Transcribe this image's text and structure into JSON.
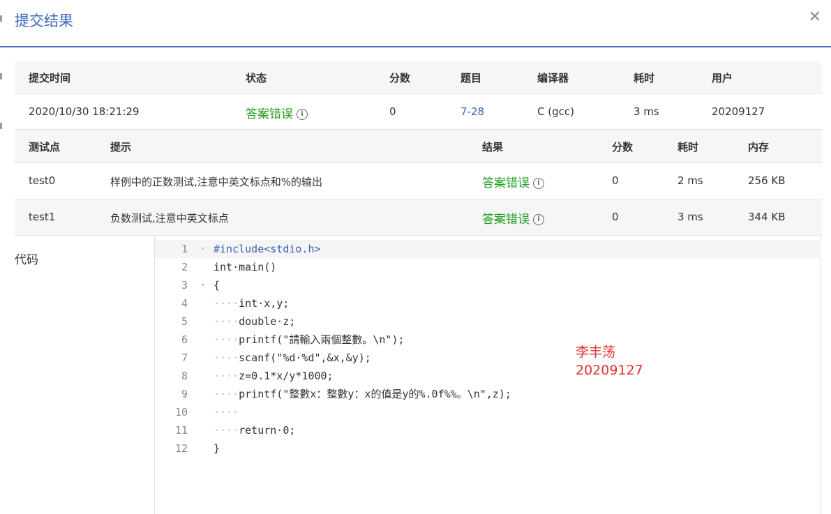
{
  "dialog": {
    "title": "提交结果",
    "close_icon": "close-icon"
  },
  "submission": {
    "headers": [
      "提交时间",
      "状态",
      "分数",
      "题目",
      "编译器",
      "耗时",
      "用户"
    ],
    "row": {
      "time": "2020/10/30 18:21:29",
      "status": "答案错误",
      "score": "0",
      "problem": "7-28",
      "compiler": "C (gcc)",
      "elapsed": "3 ms",
      "user": "20209127"
    }
  },
  "tests": {
    "headers": [
      "测试点",
      "提示",
      "结果",
      "分数",
      "耗时",
      "内存"
    ],
    "rows": [
      {
        "point": "test0",
        "hint": "样例中的正数测试,注意中英文标点和%的输出",
        "result": "答案错误",
        "score": "0",
        "elapsed": "2 ms",
        "memory": "256 KB"
      },
      {
        "point": "test1",
        "hint": "负数测试,注意中英文标点",
        "result": "答案错误",
        "score": "0",
        "elapsed": "3 ms",
        "memory": "344 KB"
      }
    ]
  },
  "code": {
    "label": "代码",
    "lines": [
      {
        "n": "1",
        "fold": "▾",
        "indent": "",
        "text": "#include<stdio.h>"
      },
      {
        "n": "2",
        "fold": "",
        "indent": "",
        "text": "int·main()"
      },
      {
        "n": "3",
        "fold": "▾",
        "indent": "",
        "text": "{"
      },
      {
        "n": "4",
        "fold": "",
        "indent": "····",
        "text": "int·x,y;"
      },
      {
        "n": "5",
        "fold": "",
        "indent": "····",
        "text": "double·z;"
      },
      {
        "n": "6",
        "fold": "",
        "indent": "····",
        "text": "printf(\"請輸入兩個整數。\\n\");"
      },
      {
        "n": "7",
        "fold": "",
        "indent": "····",
        "text": "scanf(\"%d·%d\",&x,&y);"
      },
      {
        "n": "8",
        "fold": "",
        "indent": "····",
        "text": "z=0.1*x/y*1000;"
      },
      {
        "n": "9",
        "fold": "",
        "indent": "····",
        "text": "printf(\"整數x：整數y：x的值是y的%.0f%%。\\n\",z);"
      },
      {
        "n": "10",
        "fold": "",
        "indent": "····",
        "text": ""
      },
      {
        "n": "11",
        "fold": "",
        "indent": "····",
        "text": "return·0;"
      },
      {
        "n": "12",
        "fold": "",
        "indent": "",
        "text": "}"
      }
    ]
  },
  "watermark": {
    "name": "李丰荡",
    "id": "20209127"
  }
}
